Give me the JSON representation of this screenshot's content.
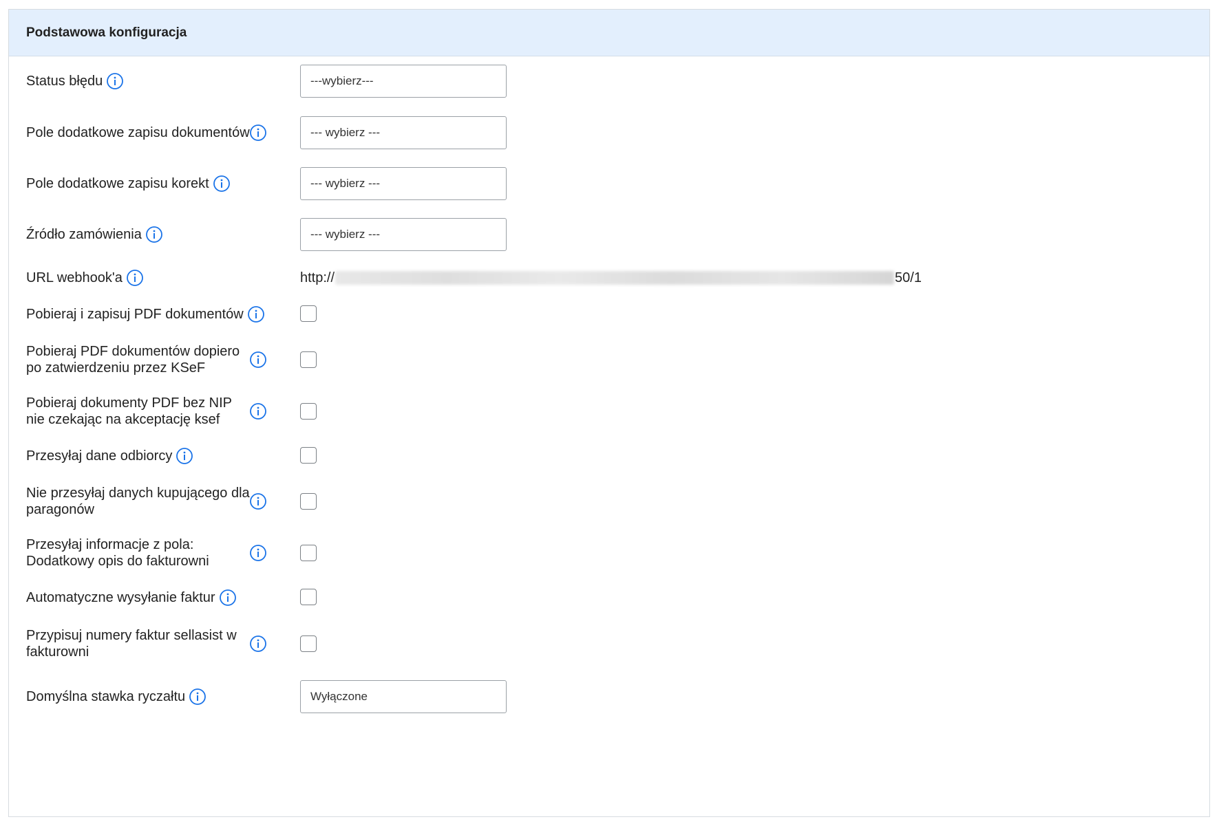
{
  "panel": {
    "title": "Podstawowa konfiguracja"
  },
  "fields": {
    "status_bledu": {
      "label": "Status błędu",
      "value": "---wybierz---"
    },
    "pole_dokumentow": {
      "label": "Pole dodatkowe zapisu dokumentów",
      "value": "--- wybierz ---"
    },
    "pole_korekt": {
      "label": "Pole dodatkowe zapisu korekt",
      "value": "--- wybierz ---"
    },
    "zrodlo": {
      "label": "Źródło zamówienia",
      "value": "--- wybierz ---"
    },
    "webhook": {
      "label": "URL webhook'a",
      "prefix": "http://",
      "suffix": "50/1"
    },
    "pdf_dokumentow": {
      "label": "Pobieraj i zapisuj PDF dokumentów",
      "checked": false
    },
    "pdf_ksef": {
      "label": "Pobieraj PDF dokumentów dopiero po zatwierdzeniu przez KSeF",
      "checked": false
    },
    "pdf_bez_nip": {
      "label": "Pobieraj dokumenty PDF bez NIP nie czekając na akceptację ksef",
      "checked": false
    },
    "dane_odbiorcy": {
      "label": "Przesyłaj dane odbiorcy",
      "checked": false
    },
    "paragony": {
      "label": "Nie przesyłaj danych kupującego dla paragonów",
      "checked": false
    },
    "opis": {
      "label": "Przesyłaj informacje z pola: Dodatkowy opis do fakturowni",
      "checked": false
    },
    "auto_wysylanie": {
      "label": "Automatyczne wysyłanie faktur",
      "checked": false
    },
    "numery_faktur": {
      "label": "Przypisuj numery faktur sellasist w fakturowni",
      "checked": false
    },
    "ryczalt": {
      "label": "Domyślna stawka ryczałtu",
      "value": "Wyłączone"
    }
  },
  "icons": {
    "info": "info-circle-icon"
  },
  "colors": {
    "header_bg": "#e3effd",
    "info_icon": "#1a73e8",
    "border": "#d6dbe0"
  }
}
